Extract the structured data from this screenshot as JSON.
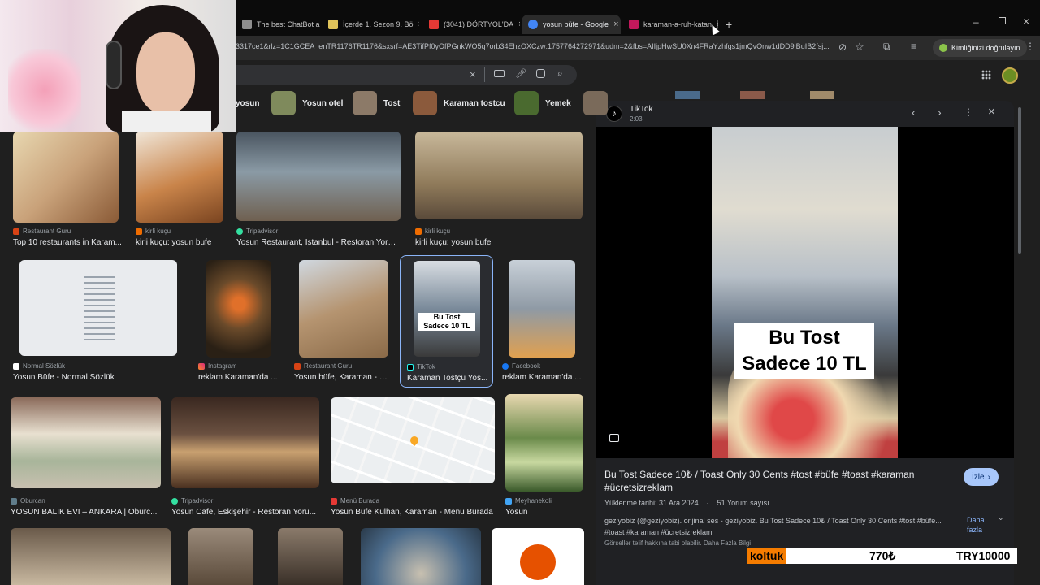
{
  "tabs": [
    {
      "title": "The best ChatBot and",
      "active": false,
      "fav": "#8e8e8e"
    },
    {
      "title": "İçerde 1. Sezon 9. Bö",
      "active": false,
      "fav": "#e0c35a"
    },
    {
      "title": "(3041) DÖRTYOL'DA",
      "active": false,
      "fav": "#e53935"
    },
    {
      "title": "yosun büfe - Google",
      "active": true,
      "fav": "#4285f4"
    },
    {
      "title": "karaman-a-ruh-katan",
      "active": false,
      "fav": "#c2185b"
    }
  ],
  "new_tab_icon": "+",
  "url": "3317ce1&rlz=1C1GCEA_enTR1176TR1176&sxsrf=AE3TifPf0yOfPGnkWO5q7orb34EhzOXCzw:1757764272971&udm=2&fbs=AIIjpHwSU0Xn4FRaYzhfgs1jmQvOnw1dDD9iBuIB2fsj...",
  "verify_label": "Kimliğinizi doğrulayın",
  "chips": [
    {
      "label": "yosun",
      "color": "#5a5a5a"
    },
    {
      "label": "Yosun otel",
      "color": "#7f8a5c"
    },
    {
      "label": "Tost",
      "color": "#8c7a68"
    },
    {
      "label": "Karaman tostcu",
      "color": "#8b5a3c"
    },
    {
      "label": "Yemek",
      "color": "#4a6a2f"
    }
  ],
  "results": [
    {
      "source": "Restaurant Guru",
      "caption": "Top 10 restaurants in Karam...",
      "color": "#c9a27a"
    },
    {
      "source": "kirli kuçu",
      "caption": "kirli kuçu: yosun bufe",
      "color": "#b5774a"
    },
    {
      "source": "Tripadvisor",
      "caption": "Yosun Restaurant, İstanbul - Restoran Yoru...",
      "color": "#6f7f8a"
    },
    {
      "source": "kirli kuçu",
      "caption": "kirli kuçu: yosun bufe",
      "color": "#8f7a5a"
    },
    {
      "source": "Normal Sözlük",
      "caption": "Yosun Büfe - Normal Sözlük",
      "color": "#e9ebee"
    },
    {
      "source": "Instagram",
      "caption": "reklam Karaman'da ...",
      "color": "#6a4a2a"
    },
    {
      "source": "Restaurant Guru",
      "caption": "Yosun büfe, Karaman - R...",
      "color": "#b59470"
    },
    {
      "source": "TikTok",
      "caption": "Karaman Tostçu Yos...",
      "color": "#7a8a9a"
    },
    {
      "source": "Facebook",
      "caption": "reklam Karaman'da ...",
      "color": "#8f9aa5"
    },
    {
      "source": "Oburcan",
      "caption": "YOSUN BALIK EVİ – ANKARA | Oburc...",
      "color": "#a8b59a"
    },
    {
      "source": "Tripadvisor",
      "caption": "Yosun Cafe, Eskişehir - Restoran Yoru...",
      "color": "#5a4030"
    },
    {
      "source": "Menü Burada",
      "caption": "Yosun Büfe Külhan, Karaman - Menü Burada",
      "color": "#eceff1"
    },
    {
      "source": "Meyhanekoli",
      "caption": "Yosun",
      "color": "#6a8a4a"
    }
  ],
  "thumb_overlay": {
    "line1": "Bu Tost",
    "line2": "Sadece 10 TL"
  },
  "panel": {
    "source": "TikTok",
    "duration": "2:03",
    "overlay_line1": "Bu Tost",
    "overlay_line2": "Sadece 10 TL",
    "title": "Bu Tost Sadece 10₺ / Toast Only 30 Cents #tost #büfe #toast #karaman #ücretsizreklam",
    "watch_label": "İzle",
    "upload_date": "Yüklenme tarihi: 31 Ara 2024",
    "comments": "51 Yorum sayısı",
    "description": "geziyobiz (@geziyobiz). orijinal ses - geziyobiz. Bu Tost Sadece 10₺ / Toast Only 30 Cents #tost #büfe... #toast #karaman #ücretsizreklam",
    "more_label": "Daha fazla",
    "copyright": "Görseller telif hakkına tabi olabilir. Daha Fazla Bilgi"
  },
  "price_bar": {
    "item": "koltuk",
    "price": "770₺",
    "total": "TRY10000"
  },
  "colors": {
    "highlight": "#f57c00",
    "tiktok": "#000000",
    "accent_button": "#a8c7fa"
  }
}
